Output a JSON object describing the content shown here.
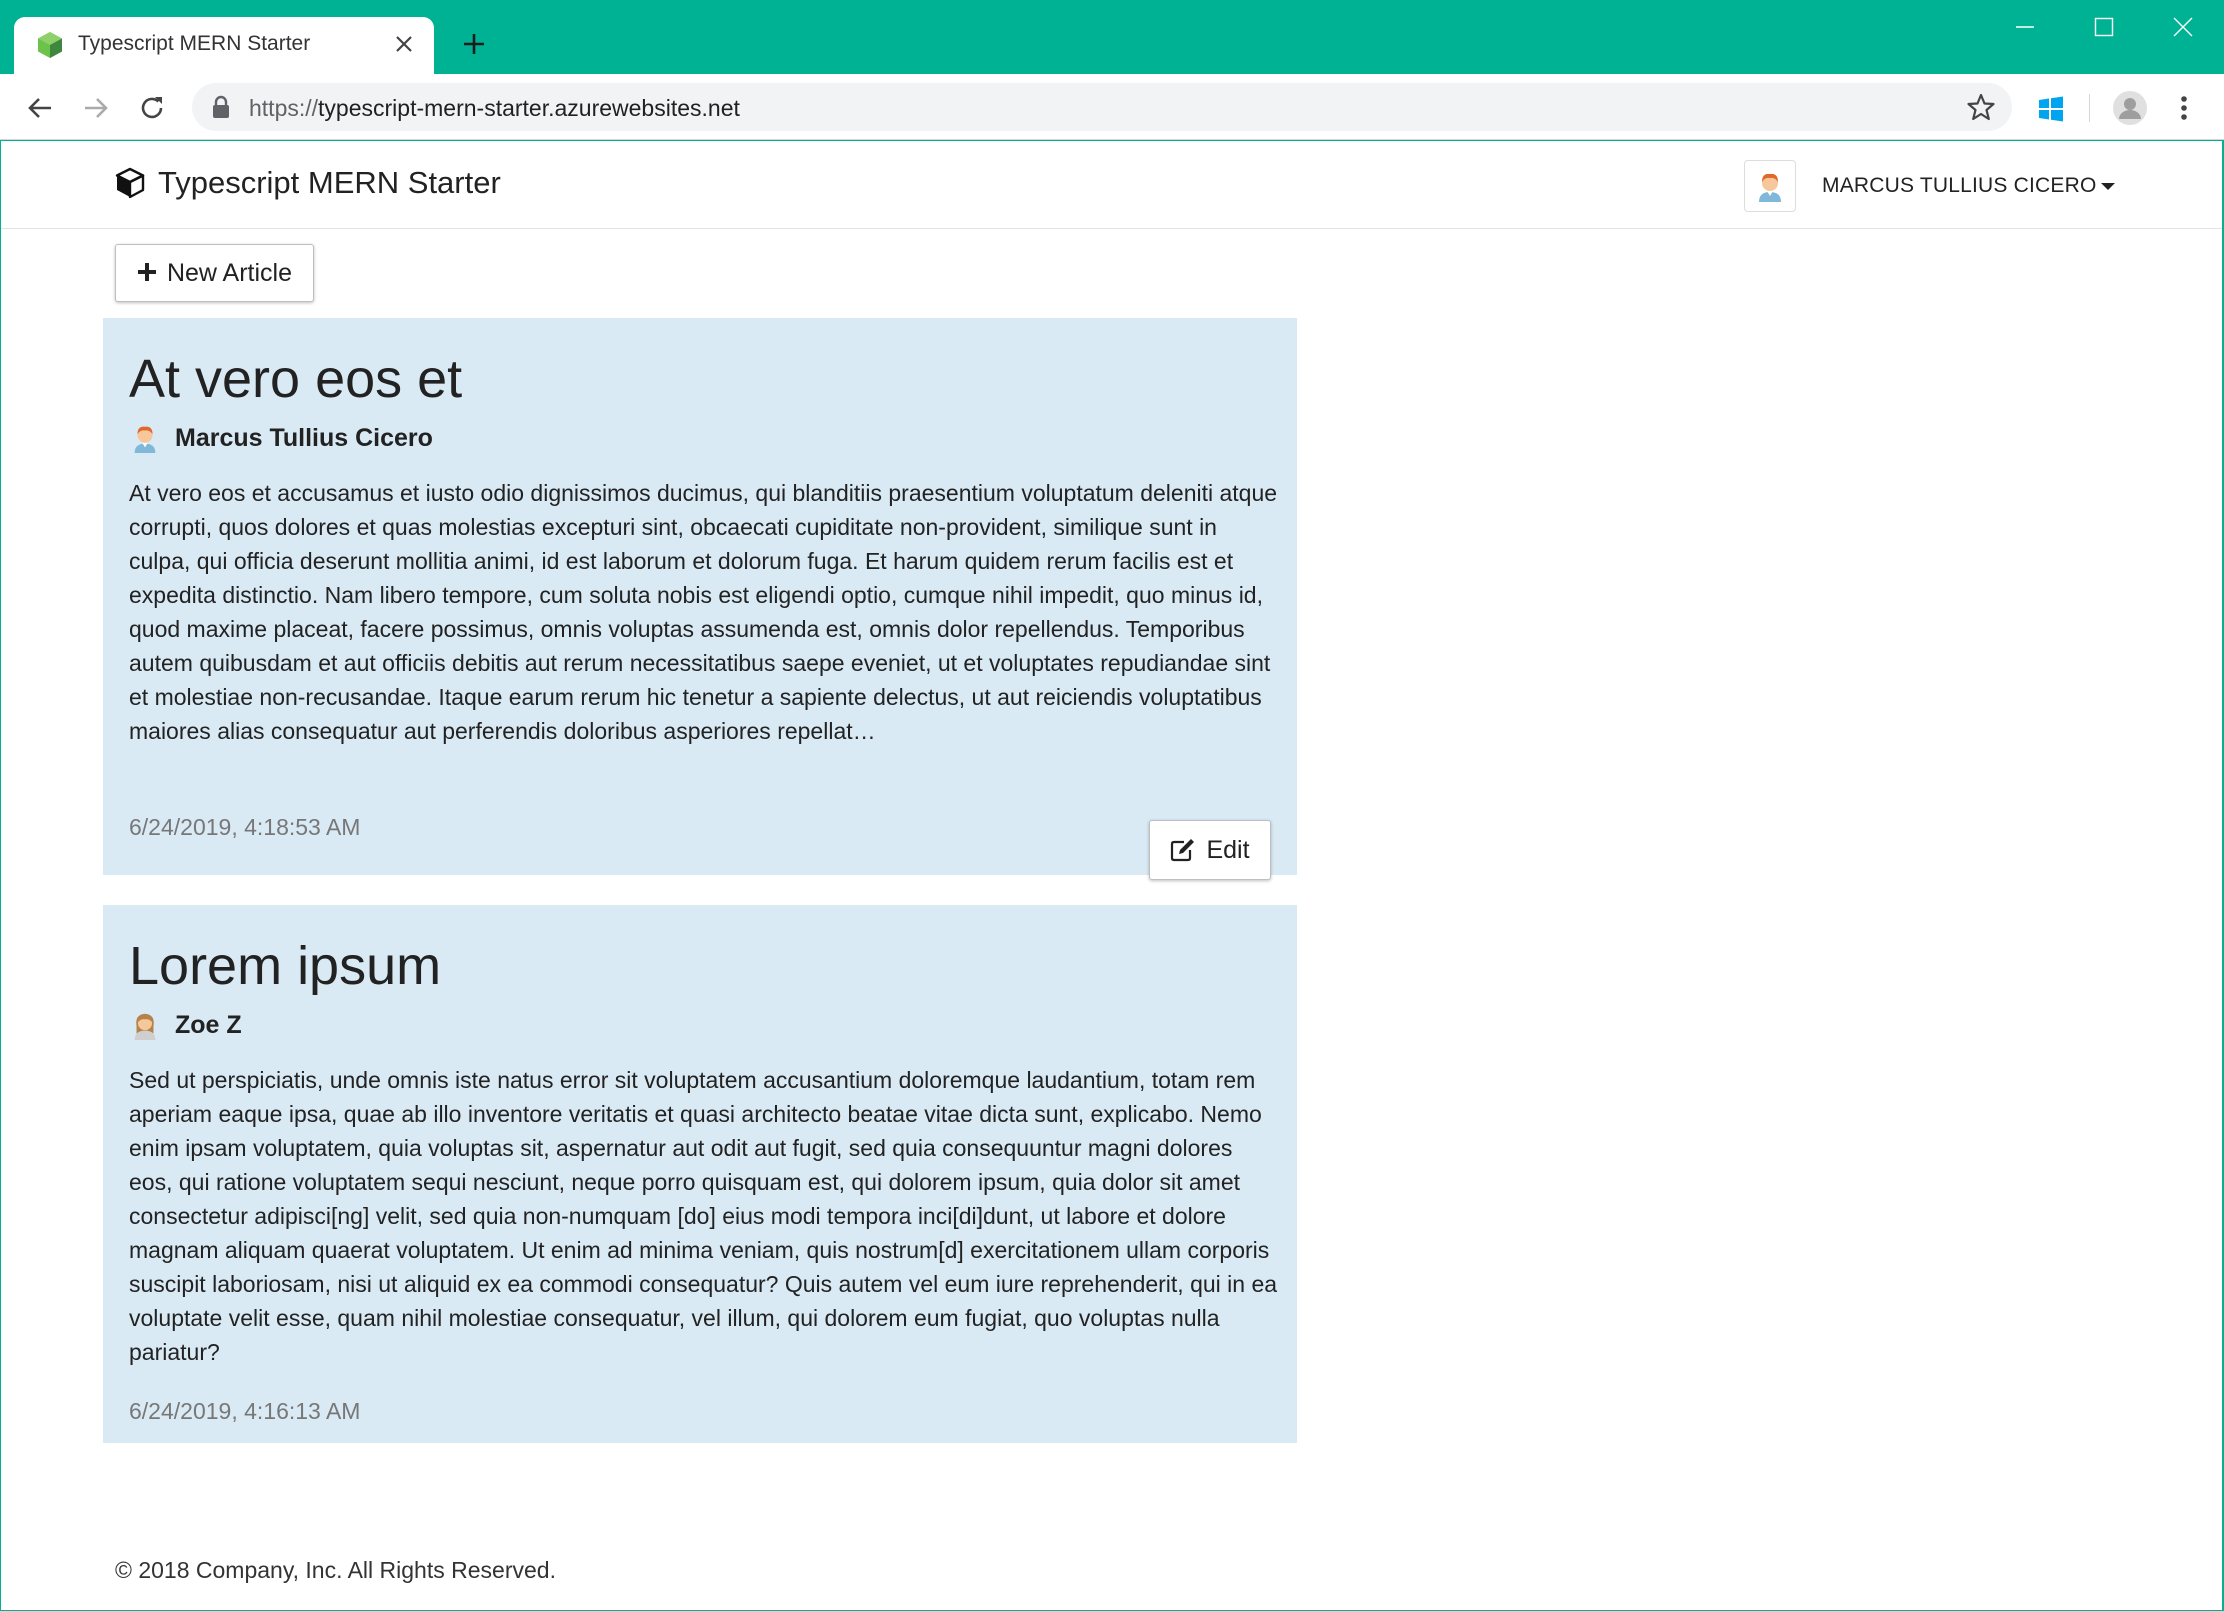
{
  "browser": {
    "tab": {
      "title": "Typescript MERN Starter",
      "favicon": "node-cube-icon"
    },
    "url": {
      "scheme": "https://",
      "host": "typescript-mern-starter.azurewebsites.net"
    },
    "frame_color": "#00b294"
  },
  "navbar": {
    "brand": "Typescript MERN Starter",
    "brand_icon": "cube-icon",
    "user": {
      "name": "MARCUS TULLIUS CICERO",
      "avatar": "male-avatar-icon"
    }
  },
  "toolbar": {
    "new_article_label": "New Article"
  },
  "articles": [
    {
      "title": "At vero eos et",
      "author": "Marcus Tullius Cicero",
      "author_avatar": "male-avatar-icon",
      "body": "At vero eos et accusamus et iusto odio dignissimos ducimus, qui blanditiis praesentium voluptatum deleniti atque corrupti, quos dolores et quas molestias excepturi sint, obcaecati cupiditate non-provident, similique sunt in culpa, qui officia deserunt mollitia animi, id est laborum et dolorum fuga. Et harum quidem rerum facilis est et expedita distinctio. Nam libero tempore, cum soluta nobis est eligendi optio, cumque nihil impedit, quo minus id, quod maxime placeat, facere possimus, omnis voluptas assumenda est, omnis dolor repellendus. Temporibus autem quibusdam et aut officiis debitis aut rerum necessitatibus saepe eveniet, ut et voluptates repudiandae sint et molestiae non-recusandae. Itaque earum rerum hic tenetur a sapiente delectus, ut aut reiciendis voluptatibus maiores alias consequatur aut perferendis doloribus asperiores repellat…",
      "date": "6/24/2019, 4:18:53 AM",
      "edit_label": "Edit"
    },
    {
      "title": "Lorem ipsum",
      "author": "Zoe Z",
      "author_avatar": "female-avatar-icon",
      "body": "Sed ut perspiciatis, unde omnis iste natus error sit voluptatem accusantium doloremque laudantium, totam rem aperiam eaque ipsa, quae ab illo inventore veritatis et quasi architecto beatae vitae dicta sunt, explicabo. Nemo enim ipsam voluptatem, quia voluptas sit, aspernatur aut odit aut fugit, sed quia consequuntur magni dolores eos, qui ratione voluptatem sequi nesciunt, neque porro quisquam est, qui dolorem ipsum, quia dolor sit amet consectetur adipisci[ng] velit, sed quia non-numquam [do] eius modi tempora inci[di]dunt, ut labore et dolore magnam aliquam quaerat voluptatem. Ut enim ad minima veniam, quis nostrum[d] exercitationem ullam corporis suscipit laboriosam, nisi ut aliquid ex ea commodi consequatur? Quis autem vel eum iure reprehenderit, qui in ea voluptate velit esse, quam nihil molestiae consequatur, vel illum, qui dolorem eum fugiat, quo voluptas nulla pariatur?",
      "date": "6/24/2019, 4:16:13 AM"
    }
  ],
  "article_background": "#d9eaf5",
  "footer": {
    "text": "© 2018 Company, Inc. All Rights Reserved."
  }
}
